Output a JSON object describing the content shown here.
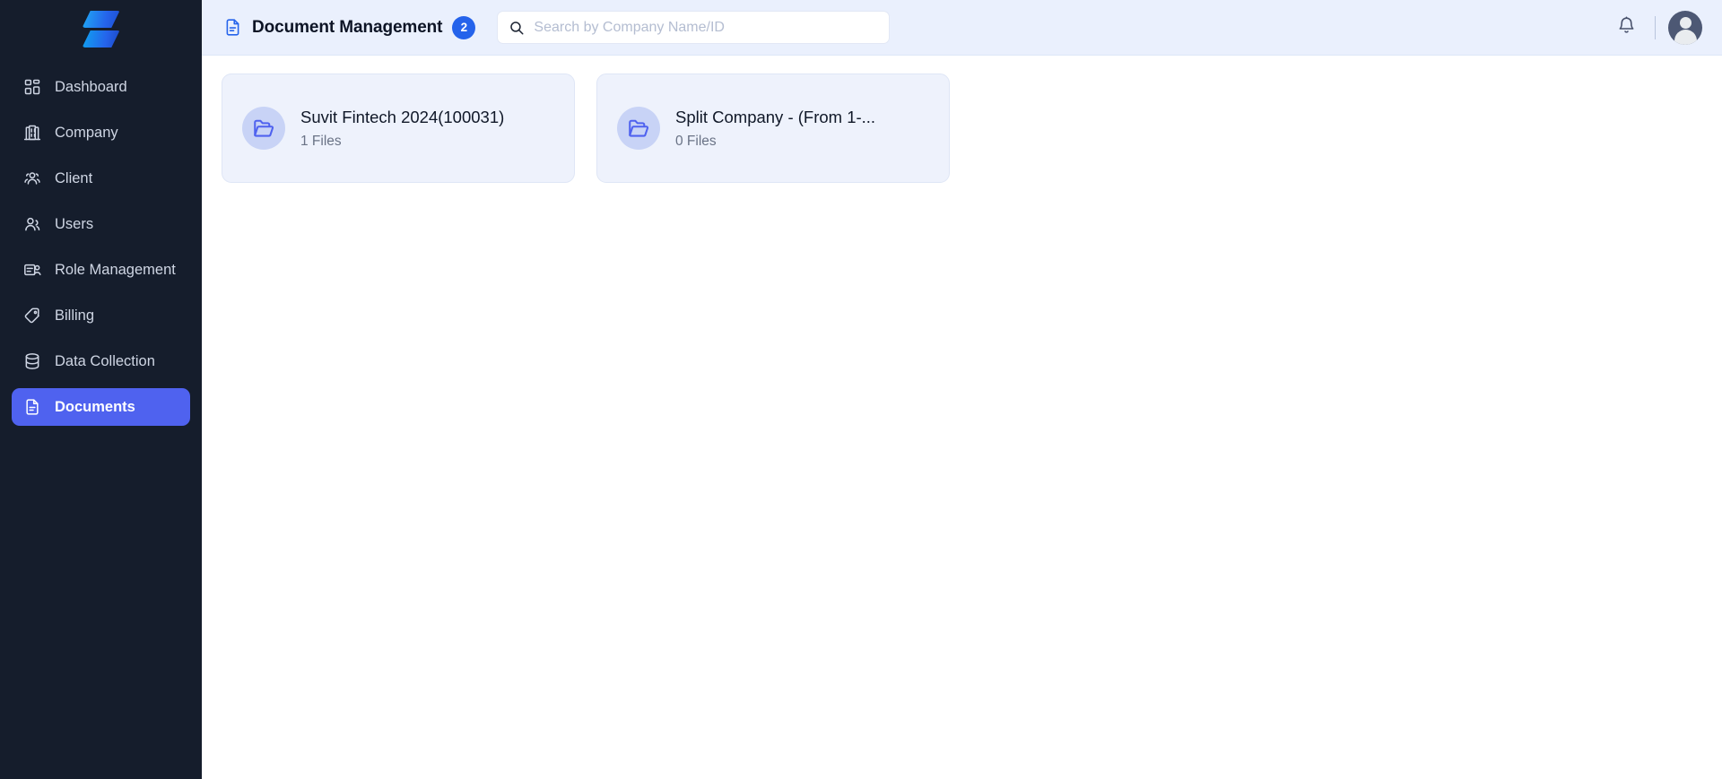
{
  "sidebar": {
    "logo_name": "suvit-logo",
    "items": [
      {
        "label": "Dashboard",
        "icon": "dashboard-icon",
        "active": false
      },
      {
        "label": "Company",
        "icon": "building-icon",
        "active": false
      },
      {
        "label": "Client",
        "icon": "users-group-icon",
        "active": false
      },
      {
        "label": "Users",
        "icon": "user-icon",
        "active": false
      },
      {
        "label": "Role Management",
        "icon": "id-card-icon",
        "active": false
      },
      {
        "label": "Billing",
        "icon": "tag-icon",
        "active": false
      },
      {
        "label": "Data Collection",
        "icon": "database-icon",
        "active": false
      },
      {
        "label": "Documents",
        "icon": "document-icon",
        "active": true
      }
    ]
  },
  "topbar": {
    "title": "Document Management",
    "title_icon": "document-icon",
    "badge_count": "2",
    "search": {
      "placeholder": "Search by Company Name/ID",
      "value": "",
      "icon": "search-icon"
    },
    "notification_icon": "bell-icon",
    "avatar_name": "user-avatar"
  },
  "content": {
    "cards": [
      {
        "name": "Suvit Fintech 2024(100031)",
        "files": "1 Files",
        "icon": "open-folder-icon"
      },
      {
        "name": "Split Company - (From 1-...",
        "files": "0 Files",
        "icon": "open-folder-icon"
      }
    ]
  },
  "colors": {
    "sidebar_bg": "#151d2c",
    "accent": "#4f62ef",
    "badge_blue": "#2563eb",
    "topbar_bg": "#eaf0fd",
    "card_bg": "#eef2fc",
    "folder_icon": "#4f62ef"
  }
}
